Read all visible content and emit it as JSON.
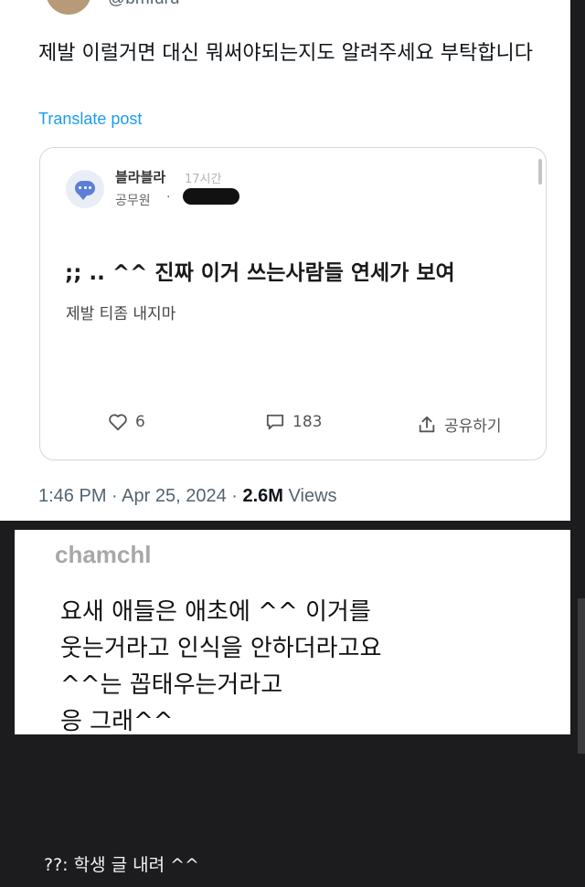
{
  "tweet": {
    "handle_partial": "@bmfuru",
    "text": "제발 이럴거면 대신 뭐써야되는지도 알려주세요 부탁합니다",
    "translate_link": "Translate post",
    "quote": {
      "author": "블라블라",
      "time": "17시간",
      "job": "공무원",
      "separator": "·",
      "headline": ";; .. ^^ 진짜 이거 쓰는사람들 연세가 보여",
      "body": "제발 티좀 내지마",
      "actions": {
        "like_count": "6",
        "comment_count": "183",
        "share_label": "공유하기"
      }
    },
    "meta": {
      "time": "1:46 PM",
      "sep1": "·",
      "date": "Apr 25, 2024",
      "sep2": "·",
      "views_count": "2.6M",
      "views_label": "Views"
    }
  },
  "reply": {
    "username": "chamchl",
    "lines": [
      "요새 애들은 애초에 ^^ 이거를",
      "웃는거라고 인식을 안하더라고요",
      "^^는 꼽태우는거라고",
      "응 그래^^"
    ]
  },
  "caption": "??: 학생 글 내려 ^^",
  "colors": {
    "background": "#1c1c1e",
    "link": "#1d9bf0",
    "muted": "#536471"
  }
}
